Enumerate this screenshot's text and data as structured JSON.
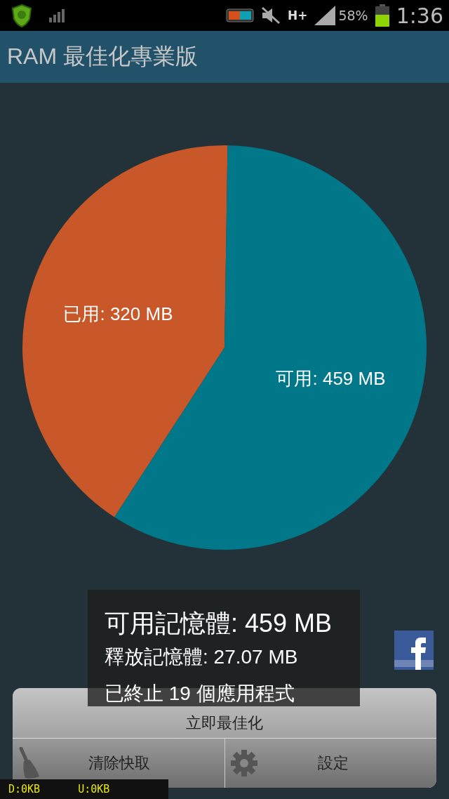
{
  "status_bar": {
    "network_type": "H+",
    "battery": "58%",
    "time": "1:36"
  },
  "app_bar": {
    "title": "RAM 最佳化專業版"
  },
  "memory_chart": {
    "chart_data": {
      "type": "pie",
      "categories": [
        "已用",
        "可用"
      ],
      "values": [
        320,
        459
      ],
      "value_labels": [
        "320 MB",
        "459 MB"
      ]
    }
  },
  "toast": {
    "lines": [
      "可用記憶體: 459 MB",
      "釋放記憶體: 27.07 MB",
      "已終止 19 個應用程式"
    ]
  },
  "buttons": {
    "optimize": "立即最佳化",
    "clear_cache": "清除快取",
    "settings": "設定"
  },
  "traffic": {
    "download": "D:0KB",
    "upload": "U:0KB"
  }
}
